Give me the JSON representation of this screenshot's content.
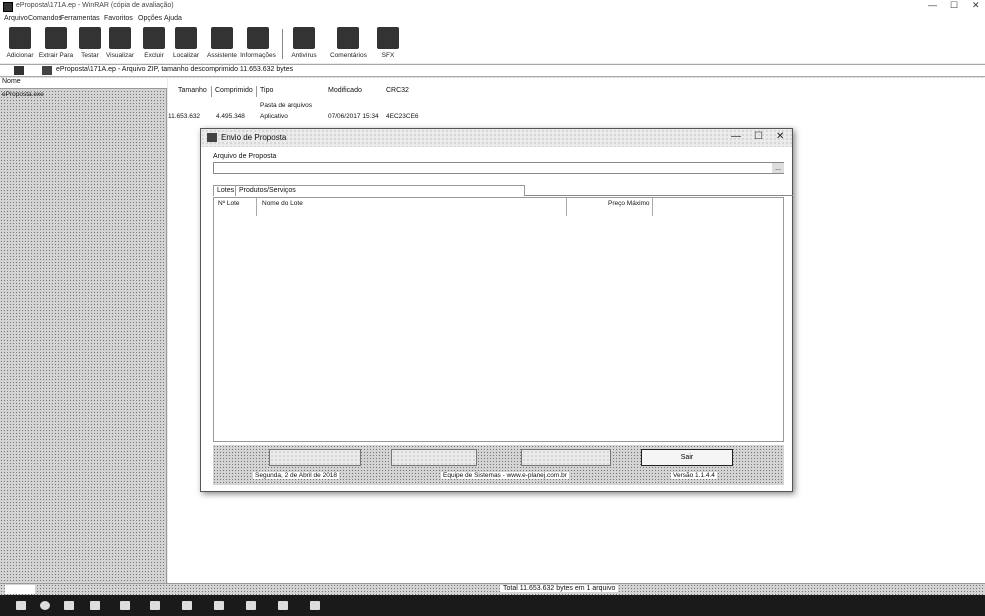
{
  "window": {
    "title": "eProposta\\171A.ep - WinRAR (cópia de avaliação)",
    "min": "—",
    "max": "☐",
    "close": "✕"
  },
  "menu": [
    "Arquivo",
    "Comandos",
    "Ferramentas",
    "Favoritos",
    "Opções",
    "Ajuda"
  ],
  "toolbar": [
    {
      "label": "Adicionar",
      "icon": "add-archive-icon"
    },
    {
      "label": "Extrair Para",
      "icon": "extract-icon"
    },
    {
      "label": "Testar",
      "icon": "test-icon"
    },
    {
      "label": "Visualizar",
      "icon": "view-icon"
    },
    {
      "label": "Excluir",
      "icon": "delete-icon"
    },
    {
      "label": "Localizar",
      "icon": "find-icon"
    },
    {
      "label": "Assistente",
      "icon": "wizard-icon"
    },
    {
      "label": "Informações",
      "icon": "info-icon"
    },
    {
      "label": "Antivírus",
      "icon": "antivirus-icon"
    },
    {
      "label": "Comentários",
      "icon": "comment-icon"
    },
    {
      "label": "SFX",
      "icon": "sfx-icon"
    }
  ],
  "pathbar": {
    "text": "eProposta\\171A.ep - Arquivo ZIP, tamanho descomprimido 11.653.632 bytes"
  },
  "tree": {
    "header": "Nome",
    "item": "eProposta.exe"
  },
  "filelist": {
    "columns": [
      "Tamanho",
      "Comprimido",
      "Tipo",
      "Modificado",
      "CRC32"
    ],
    "parent_row_type": "Pasta de arquivos",
    "row": {
      "size": "11.653.632",
      "packed": "4.495.348",
      "type": "Aplicativo",
      "modified": "07/06/2017 15:34",
      "crc": "4EC23CE6"
    }
  },
  "status": {
    "left": "",
    "text": "Total 11.653.632 bytes em 1 arquivo"
  },
  "dialog": {
    "title": "Envio de Proposta",
    "file_label": "Arquivo de Proposta",
    "file_value": "",
    "browse": "...",
    "tabs": [
      "Lotes",
      "Produtos/Serviços"
    ],
    "grid_columns": [
      "Nº Lote",
      "Nome do Lote",
      "Preço Máximo"
    ],
    "buttons": [
      "",
      "",
      "",
      "Sair"
    ],
    "footer_date": "Segunda, 2 de Abril de 2018",
    "footer_team": "Equipe de Sistemas - www.e-planej.com.br",
    "footer_version": "Versão 1.1.4.4"
  },
  "taskbar": {
    "time": "",
    "date": ""
  }
}
